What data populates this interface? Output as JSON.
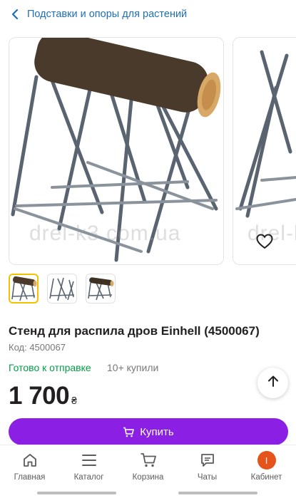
{
  "header": {
    "breadcrumb": "Подставки и опоры для растений",
    "back_icon": "chevron-left-icon"
  },
  "gallery": {
    "watermark": "drel-k3.com.ua",
    "favorite_icon": "heart-icon",
    "thumbnail_count": 3,
    "active_thumbnail": 1
  },
  "product": {
    "title": "Стенд для распила дров Einhell (4500067)",
    "code_label": "Код: 4500067",
    "stock_status": "Готово к отправке",
    "bought": "10+ купили",
    "price": "1 700",
    "currency": "₴"
  },
  "buy_button": {
    "label": "Купить",
    "icon": "cart-icon"
  },
  "nav": {
    "items": [
      {
        "label": "Главная",
        "icon": "home-icon"
      },
      {
        "label": "Каталог",
        "icon": "menu-icon"
      },
      {
        "label": "Корзина",
        "icon": "cart-icon"
      },
      {
        "label": "Чаты",
        "icon": "chat-icon"
      },
      {
        "label": "Кабинет",
        "icon": "avatar-icon",
        "avatar_letter": "I"
      }
    ]
  },
  "colors": {
    "link": "#1e6fb8",
    "stock": "#00a046",
    "buy": "#8b1fe3",
    "avatar": "#e4541b",
    "thumb_active": "#f2c200"
  }
}
